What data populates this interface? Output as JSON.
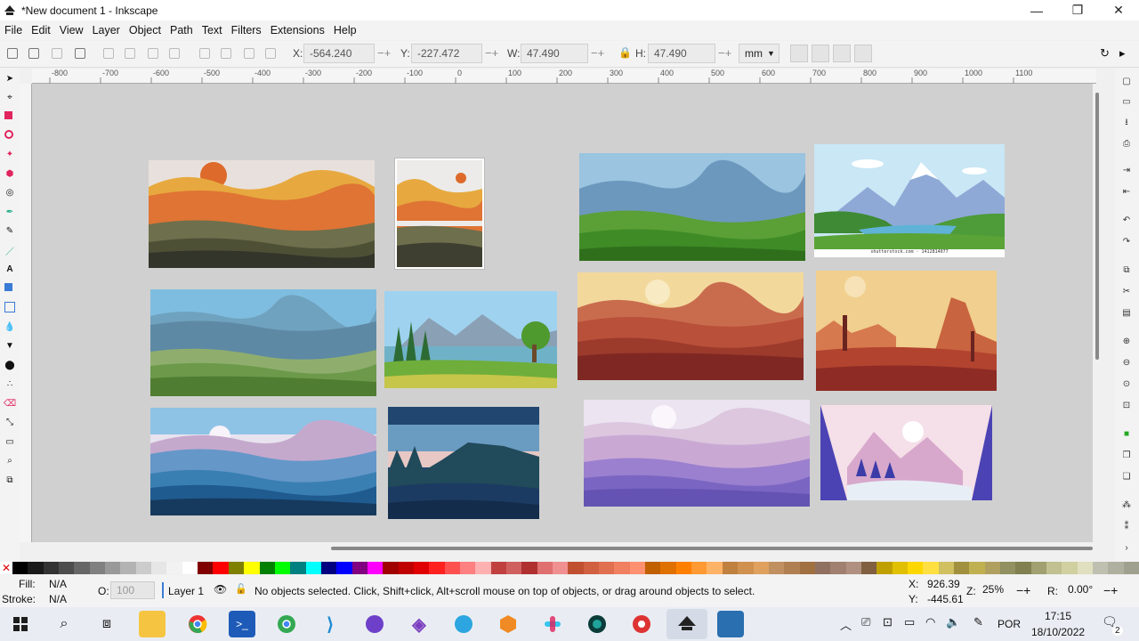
{
  "window": {
    "title": "*New document 1 - Inkscape",
    "minimize": "—",
    "maximize": "❐",
    "close": "✕"
  },
  "menu": [
    "File",
    "Edit",
    "View",
    "Layer",
    "Object",
    "Path",
    "Text",
    "Filters",
    "Extensions",
    "Help"
  ],
  "toolbar": {
    "x_label": "X:",
    "x_value": "-564.240",
    "y_label": "Y:",
    "y_value": "-227.472",
    "w_label": "W:",
    "w_value": "47.490",
    "h_label": "H:",
    "h_value": "47.490",
    "unit": "mm"
  },
  "ruler_labels": [
    "-800",
    "-700",
    "-600",
    "-500",
    "-400",
    "-300",
    "-200",
    "-100",
    "0",
    "100",
    "200",
    "300",
    "400",
    "500",
    "600",
    "700",
    "800",
    "900",
    "1000",
    "1100"
  ],
  "status": {
    "fill_label": "Fill:",
    "fill_value": "N/A",
    "stroke_label": "Stroke:",
    "stroke_value": "N/A",
    "opacity_label": "O:",
    "opacity_value": "100",
    "layer": "Layer 1",
    "message": "No objects selected. Click, Shift+click, Alt+scroll mouse on top of objects, or drag around objects to select.",
    "cursor_x_label": "X:",
    "cursor_x": "926.39",
    "cursor_y_label": "Y:",
    "cursor_y": "-445.61",
    "zoom_label": "Z:",
    "zoom": "25%",
    "rotate_label": "R:",
    "rotate": "0.00°"
  },
  "watermark_text": "shutterstock.com · 1412814077",
  "taskbar": {
    "language": "POR",
    "time": "17:15",
    "date": "18/10/2022",
    "notifications": "2"
  },
  "palette_colors": [
    "#000000",
    "#1a1a1a",
    "#333333",
    "#4d4d4d",
    "#666666",
    "#808080",
    "#999999",
    "#b3b3b3",
    "#cccccc",
    "#e6e6e6",
    "#f2f2f2",
    "#ffffff",
    "#800000",
    "#ff0000",
    "#808000",
    "#ffff00",
    "#008000",
    "#00ff00",
    "#008080",
    "#00ffff",
    "#000080",
    "#0000ff",
    "#800080",
    "#ff00ff",
    "#a00000",
    "#c00000",
    "#e00000",
    "#ff2020",
    "#ff5050",
    "#ff8080",
    "#ffb0b0",
    "#c04040",
    "#d06060",
    "#b03030",
    "#e07070",
    "#f09090",
    "#c05030",
    "#d06040",
    "#e07050",
    "#f08060",
    "#ff9070",
    "#c06000",
    "#e07000",
    "#ff8000",
    "#ff9933",
    "#ffb366",
    "#c08040",
    "#d09050",
    "#e0a060",
    "#c09060",
    "#b08050",
    "#a07040",
    "#907060",
    "#a08070",
    "#b09080",
    "#806040",
    "#c0a000",
    "#e0c000",
    "#ffd700",
    "#ffe040",
    "#d0c060",
    "#a09040",
    "#c0b050",
    "#b0a060",
    "#909060",
    "#808050",
    "#a0a070",
    "#c0c090",
    "#d0d0a0",
    "#e0e0c0",
    "#c0c0b0",
    "#b0b0a0",
    "#a0a090"
  ]
}
